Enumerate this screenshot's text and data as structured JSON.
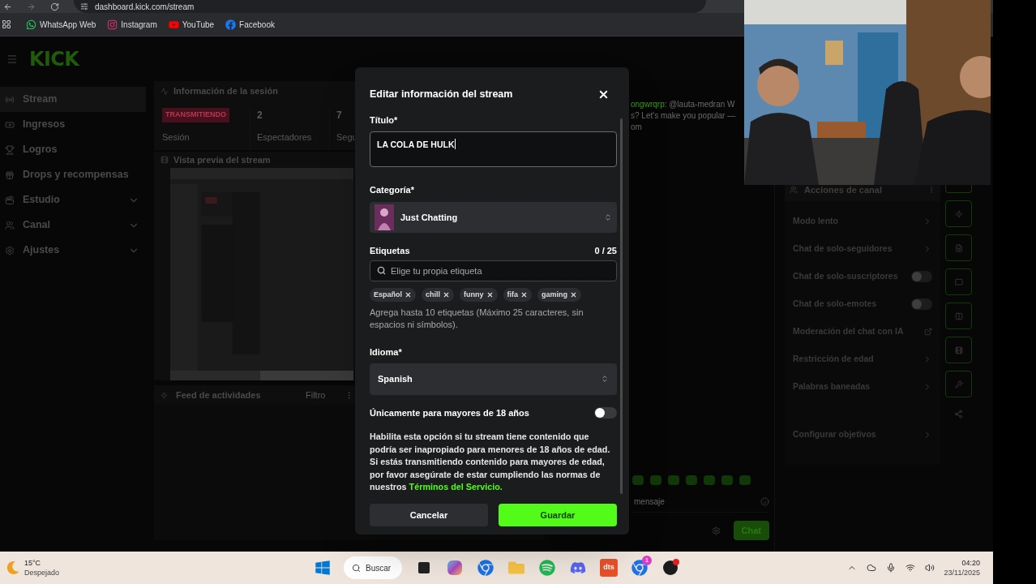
{
  "browser": {
    "url": "dashboard.kick.com/stream",
    "bookmarks": [
      {
        "label": "WhatsApp Web",
        "kind": "whatsapp"
      },
      {
        "label": "Instagram",
        "kind": "instagram"
      },
      {
        "label": "YouTube",
        "kind": "youtube"
      },
      {
        "label": "Facebook",
        "kind": "facebook"
      }
    ]
  },
  "header": {
    "logo": "KICK"
  },
  "sidebar": {
    "items": [
      {
        "label": "Stream",
        "kind": "stream",
        "selected": true,
        "expandable": false
      },
      {
        "label": "Ingresos",
        "kind": "income",
        "selected": false,
        "expandable": false
      },
      {
        "label": "Logros",
        "kind": "trophy",
        "selected": false,
        "expandable": false
      },
      {
        "label": "Drops y recompensas",
        "kind": "drops",
        "selected": false,
        "expandable": false
      },
      {
        "label": "Estudio",
        "kind": "studio",
        "selected": false,
        "expandable": true
      },
      {
        "label": "Canal",
        "kind": "channel",
        "selected": false,
        "expandable": true
      },
      {
        "label": "Ajustes",
        "kind": "settings",
        "selected": false,
        "expandable": true
      }
    ]
  },
  "session": {
    "title": "Información de la sesión",
    "status": "TRANSMITIENDO",
    "status_label": "Sesión",
    "stats": [
      {
        "value": "2",
        "label": "Espectadores"
      },
      {
        "value": "7",
        "label": "Segu"
      }
    ]
  },
  "preview": {
    "title": "Vista previa del stream",
    "kind": "picture"
  },
  "feed": {
    "title": "Feed de actividades",
    "filter": "Filtro"
  },
  "chat": {
    "user": "ongwrqrp:",
    "lines": [
      "@lauta-medran W",
      "s? Let's make you popular —",
      "om"
    ],
    "placeholder": "mensaje",
    "send": "Chat"
  },
  "channel_actions": {
    "title": "Acciones de canal",
    "items": [
      {
        "label": "Modo lento",
        "kind": "link"
      },
      {
        "label": "Chat de solo-seguidores",
        "kind": "link"
      },
      {
        "label": "Chat de solo-suscriptores",
        "kind": "toggle",
        "on": false
      },
      {
        "label": "Chat de solo-emotes",
        "kind": "toggle",
        "on": false
      },
      {
        "label": "Moderación del chat con IA",
        "kind": "external"
      },
      {
        "label": "Restricción de edad",
        "kind": "link"
      },
      {
        "label": "Palabras baneadas",
        "kind": "link"
      },
      {
        "label": "Configurar objetivos",
        "kind": "link"
      }
    ]
  },
  "modal": {
    "title": "Editar información del stream",
    "title_field": {
      "label": "Título*",
      "value": "LA COLA DE HULK"
    },
    "category": {
      "label": "Categoría*",
      "value": "Just Chatting"
    },
    "tags": {
      "label": "Etiquetas",
      "count": "0 / 25",
      "placeholder": "Elige tu propia etiqueta",
      "items": [
        "Español",
        "chill",
        "funny",
        "fifa",
        "gaming"
      ],
      "hint": "Agrega hasta 10 etiquetas (Máximo 25 caracteres, sin espacios ni símbolos)."
    },
    "language": {
      "label": "Idioma*",
      "value": "Spanish"
    },
    "adult": {
      "label": "Únicamente para mayores de 18 años",
      "on": false
    },
    "description": "Habilita esta opción si tu stream tiene contenido que podría ser inapropiado para menores de 18 años de edad. Si estás transmitiendo contenido para mayores de edad, por favor asegúrate de estar cumpliendo las normas de nuestros",
    "terms_link": "Términos del Servicio.",
    "buttons": [
      "Cancelar",
      "Guardar"
    ]
  },
  "taskbar": {
    "temperature": "15°C",
    "weather": "Despejado",
    "search": "Buscar",
    "apps": [
      {
        "kind": "taskview"
      },
      {
        "kind": "copilot"
      },
      {
        "kind": "chrome"
      },
      {
        "kind": "files"
      },
      {
        "kind": "spotify"
      },
      {
        "kind": "discord"
      },
      {
        "kind": "dts"
      },
      {
        "kind": "chrome",
        "badge": "1"
      },
      {
        "kind": "dark"
      }
    ],
    "dts_label": "dts",
    "time": "04:20",
    "date": "23/11/2025"
  }
}
